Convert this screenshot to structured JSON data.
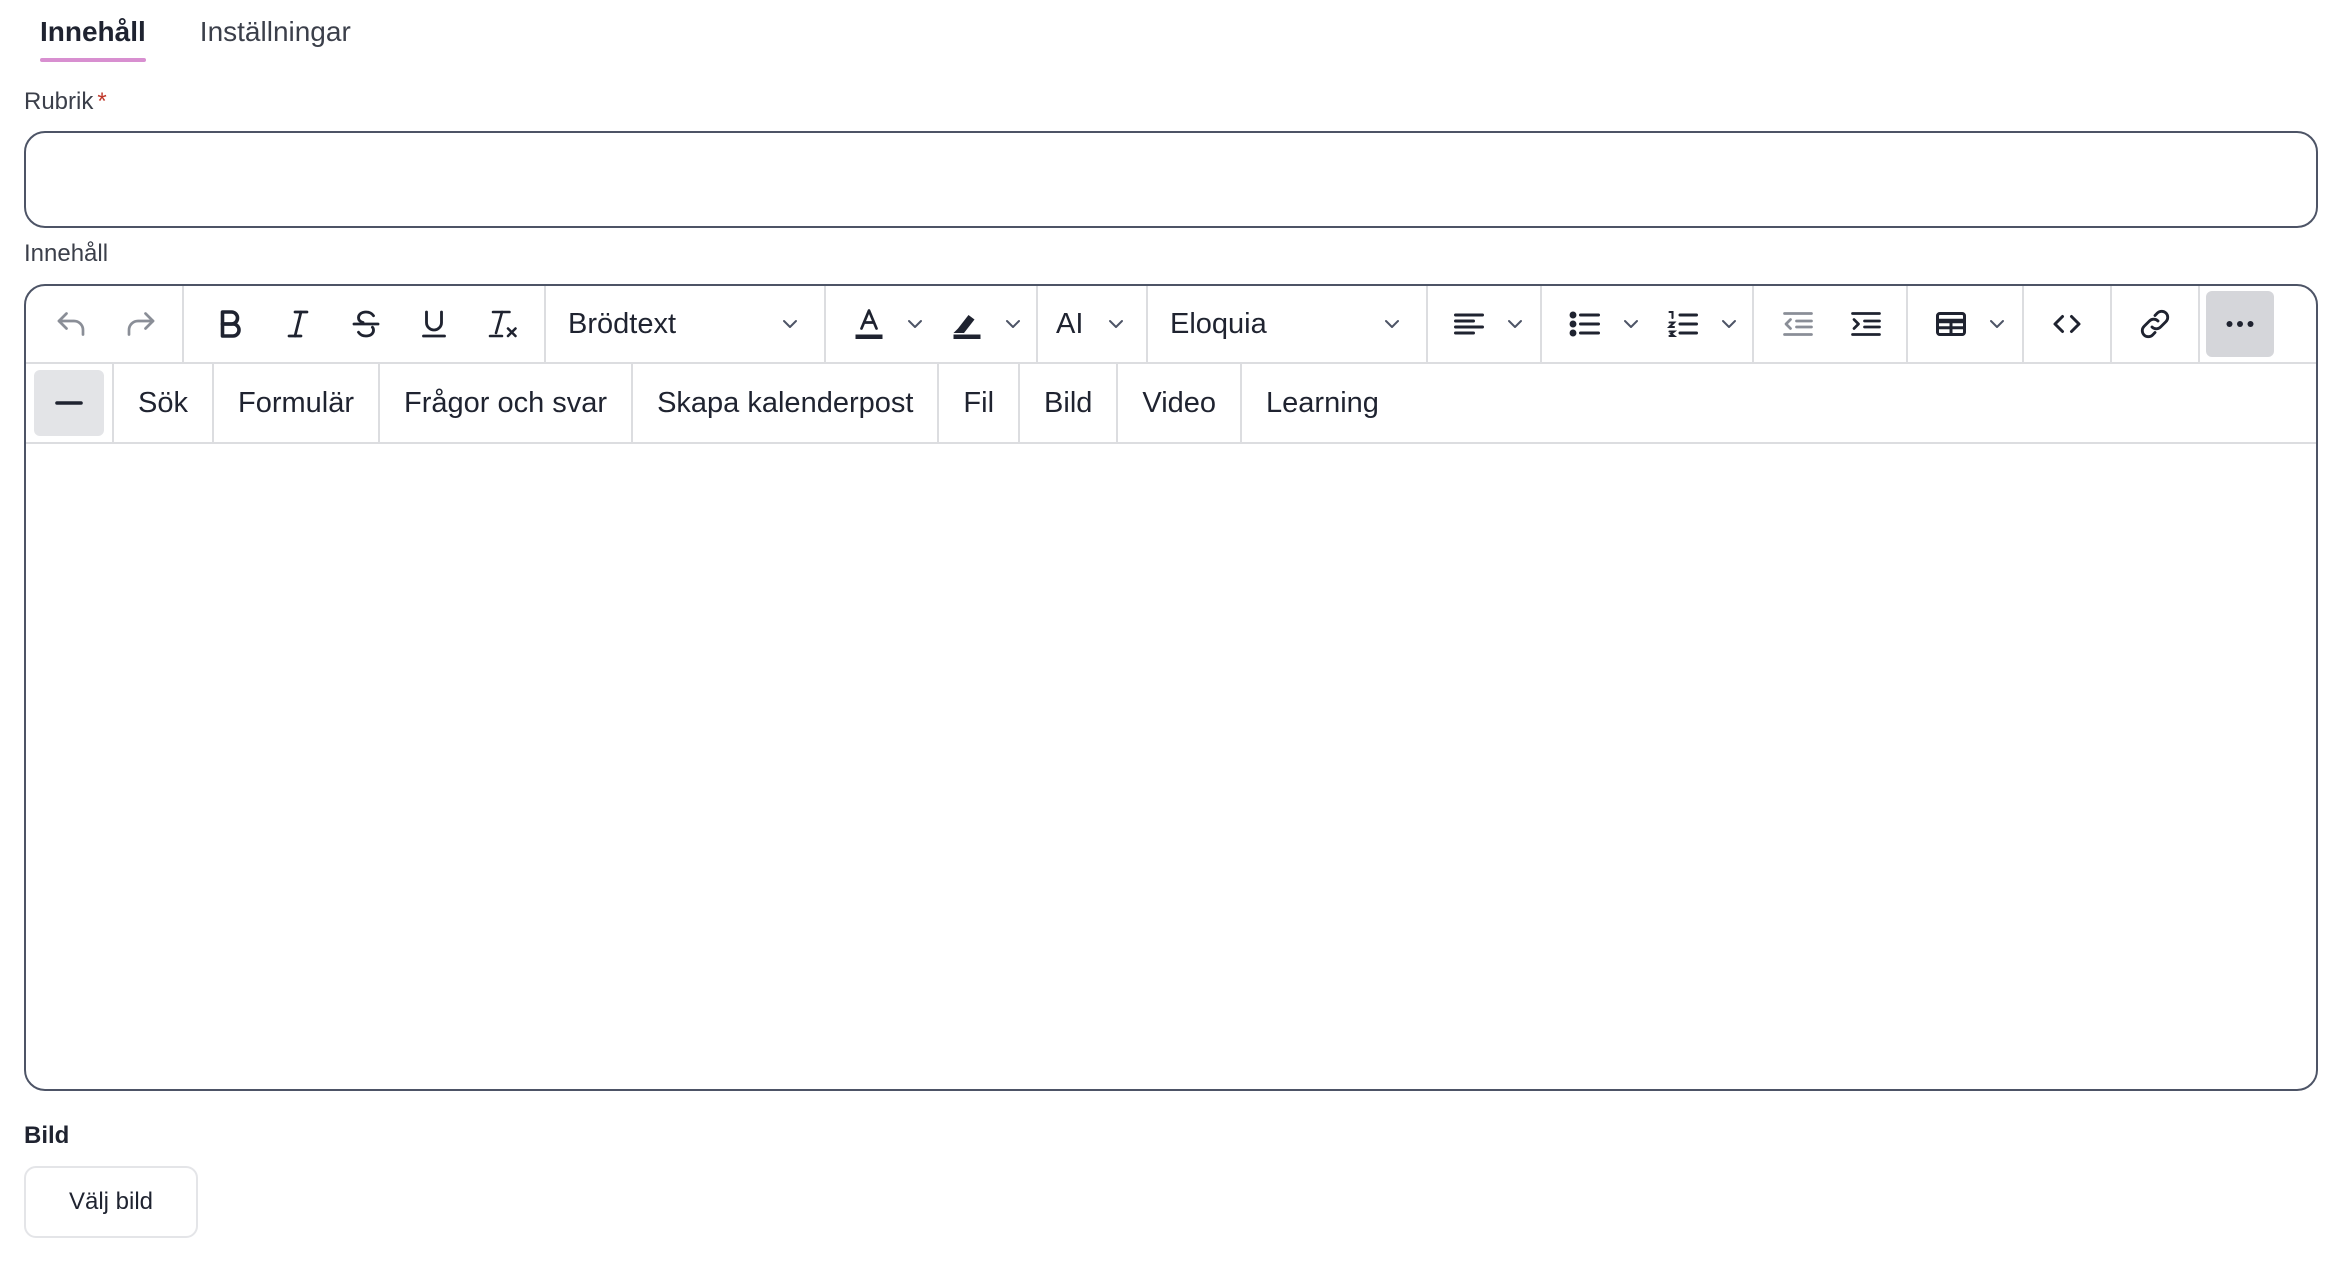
{
  "tabs": [
    {
      "label": "Innehåll",
      "active": true
    },
    {
      "label": "Inställningar",
      "active": false
    }
  ],
  "form": {
    "rubrik_label": "Rubrik",
    "required_mark": "*",
    "rubrik_value": "",
    "content_label": "Innehåll"
  },
  "editor": {
    "block_format": "Brödtext",
    "ai_label": "AI",
    "font_family": "Eloquia",
    "icons": [
      "undo-icon",
      "redo-icon",
      "bold-icon",
      "italic-icon",
      "strikethrough-icon",
      "underline-icon",
      "clear-formatting-icon",
      "text-color-icon",
      "highlight-icon",
      "align-left-icon",
      "bullet-list-icon",
      "numbered-list-icon",
      "outdent-icon",
      "indent-icon",
      "table-icon",
      "code-icon",
      "link-icon",
      "more-icon",
      "horizontal-line-icon"
    ],
    "plugins": [
      "Sök",
      "Formulär",
      "Frågor och svar",
      "Skapa kalenderpost",
      "Fil",
      "Bild",
      "Video",
      "Learning"
    ]
  },
  "image_section": {
    "title": "Bild",
    "button_label": "Välj bild"
  },
  "colors": {
    "tab_underline": "#d88fd0",
    "required": "#c0392b",
    "border": "#4d5466"
  }
}
